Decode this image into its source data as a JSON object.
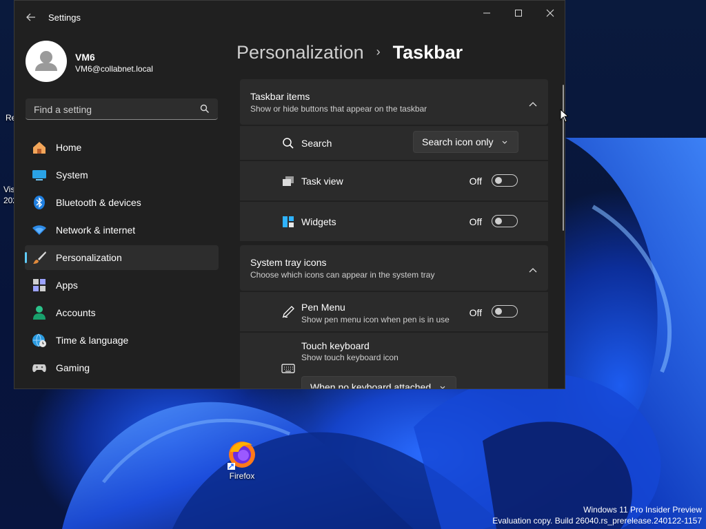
{
  "desktop": {
    "left_fragments": [
      "Re",
      "Vis",
      "202"
    ],
    "firefox_label": "Firefox",
    "watermark_line1": "Windows 11 Pro Insider Preview",
    "watermark_line2": "Evaluation copy. Build 26040.rs_prerelease.240122-1157"
  },
  "window": {
    "title": "Settings",
    "user": {
      "name": "VM6",
      "email": "VM6@collabnet.local"
    },
    "search_placeholder": "Find a setting",
    "accent": "#60cdff",
    "nav": [
      {
        "label": "Home",
        "icon": "home-icon"
      },
      {
        "label": "System",
        "icon": "system-icon"
      },
      {
        "label": "Bluetooth & devices",
        "icon": "bluetooth-icon"
      },
      {
        "label": "Network & internet",
        "icon": "network-icon"
      },
      {
        "label": "Personalization",
        "icon": "brush-icon",
        "active": true
      },
      {
        "label": "Apps",
        "icon": "apps-icon"
      },
      {
        "label": "Accounts",
        "icon": "accounts-icon"
      },
      {
        "label": "Time & language",
        "icon": "globe-clock-icon"
      },
      {
        "label": "Gaming",
        "icon": "gamepad-icon"
      }
    ]
  },
  "content": {
    "breadcrumb_parent": "Personalization",
    "breadcrumb_separator": "›",
    "breadcrumb_current": "Taskbar",
    "taskbar_items": {
      "title": "Taskbar items",
      "subtitle": "Show or hide buttons that appear on the taskbar",
      "search": {
        "label": "Search",
        "value": "Search icon only"
      },
      "task_view": {
        "label": "Task view",
        "state": "Off"
      },
      "widgets": {
        "label": "Widgets",
        "state": "Off"
      }
    },
    "system_tray": {
      "title": "System tray icons",
      "subtitle": "Choose which icons can appear in the system tray",
      "pen_menu": {
        "label": "Pen Menu",
        "sub": "Show pen menu icon when pen is in use",
        "state": "Off"
      },
      "touch_keyboard": {
        "label": "Touch keyboard",
        "sub": "Show touch keyboard icon",
        "value": "When no keyboard attached"
      }
    }
  }
}
